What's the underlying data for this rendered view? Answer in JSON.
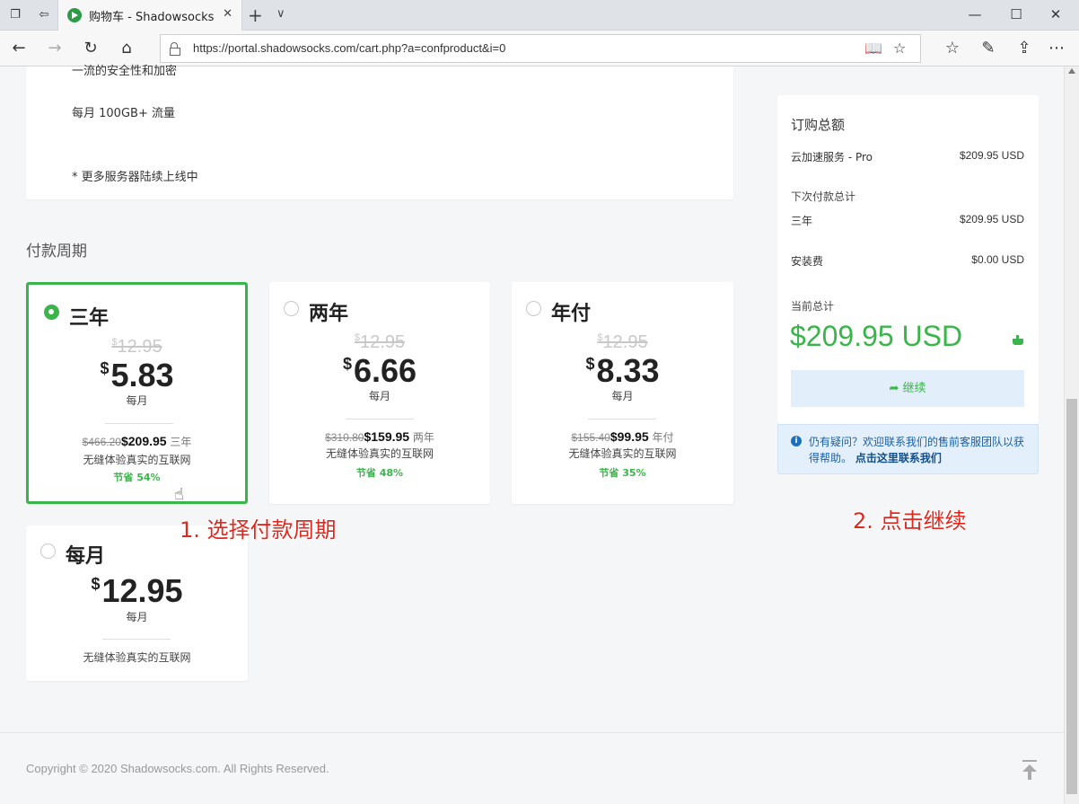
{
  "browser": {
    "tab_title": "购物车 - Shadowsocks.c",
    "url": "https://portal.shadowsocks.com/cart.php?a=confproduct&i=0"
  },
  "description": {
    "line1": "一流的安全性和加密",
    "line2": "每月 100GB+ 流量",
    "line3": "* 更多服务器陆续上线中"
  },
  "billing": {
    "section_title": "付款周期",
    "plans": [
      {
        "name": "三年",
        "old_currency": "$",
        "old_price": "12.95",
        "currency": "$",
        "price": "5.83",
        "per": "每月",
        "total_strike": "$466.20",
        "total_now": "$209.95",
        "total_suffix": "三年",
        "tagline": "无缝体验真实的互联网",
        "save": "节省 54%",
        "selected": true
      },
      {
        "name": "两年",
        "old_currency": "$",
        "old_price": "12.95",
        "currency": "$",
        "price": "6.66",
        "per": "每月",
        "total_strike": "$310.80",
        "total_now": "$159.95",
        "total_suffix": "两年",
        "tagline": "无缝体验真实的互联网",
        "save": "节省 48%",
        "selected": false
      },
      {
        "name": "年付",
        "old_currency": "$",
        "old_price": "12.95",
        "currency": "$",
        "price": "8.33",
        "per": "每月",
        "total_strike": "$155.40",
        "total_now": "$99.95",
        "total_suffix": "年付",
        "tagline": "无缝体验真实的互联网",
        "save": "节省 35%",
        "selected": false
      },
      {
        "name": "每月",
        "currency": "$",
        "price": "12.95",
        "per": "每月",
        "tagline": "无缝体验真实的互联网",
        "selected": false
      }
    ]
  },
  "annotations": {
    "step1": "1. 选择付款周期",
    "step2": "2. 点击继续"
  },
  "summary": {
    "title": "订购总额",
    "product_label": "云加速服务 - Pro",
    "product_price": "$209.95 USD",
    "recurring_label": "下次付款总计",
    "cycle_label": "三年",
    "cycle_price": "$209.95 USD",
    "setup_label": "安装费",
    "setup_price": "$0.00 USD",
    "current_label": "当前总计",
    "total": "$209.95 USD",
    "continue_label": "继续"
  },
  "help": {
    "text": "仍有疑问？欢迎联系我们的售前客服团队以获得帮助。",
    "link": "点击这里联系我们"
  },
  "footer": {
    "copyright": "Copyright © 2020 Shadowsocks.com. All Rights Reserved."
  },
  "colors": {
    "accent_green": "#3ab54a",
    "help_blue": "#1a6fbf",
    "annotation_red": "#e0281f"
  }
}
